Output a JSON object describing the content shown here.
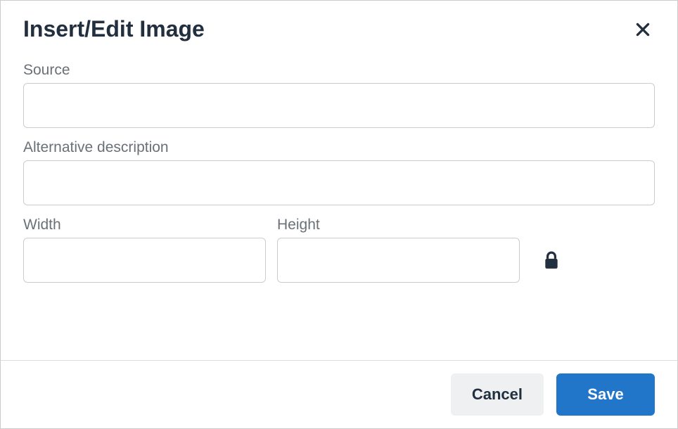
{
  "dialog": {
    "title": "Insert/Edit Image"
  },
  "fields": {
    "source": {
      "label": "Source",
      "value": ""
    },
    "alt": {
      "label": "Alternative description",
      "value": ""
    },
    "width": {
      "label": "Width",
      "value": ""
    },
    "height": {
      "label": "Height",
      "value": ""
    }
  },
  "footer": {
    "cancel_label": "Cancel",
    "save_label": "Save"
  }
}
